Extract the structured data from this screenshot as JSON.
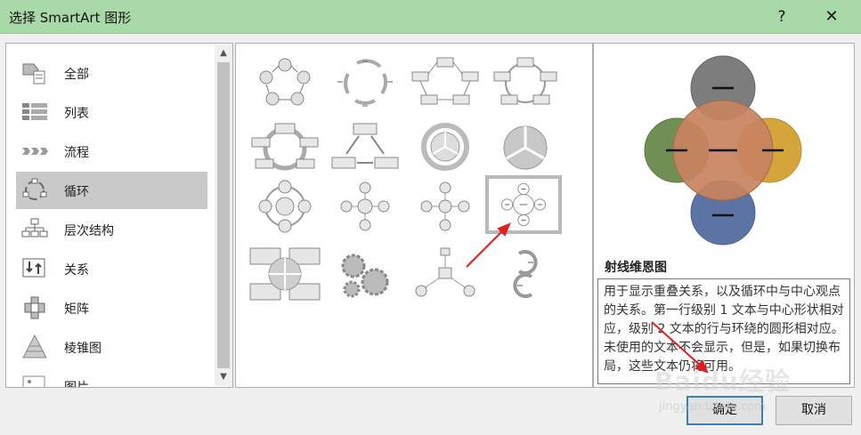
{
  "window": {
    "title": "选择 SmartArt 图形",
    "help_label": "?",
    "close_label": "✕"
  },
  "categories": [
    {
      "label": "全部",
      "icon": "all-icon"
    },
    {
      "label": "列表",
      "icon": "list-icon"
    },
    {
      "label": "流程",
      "icon": "process-icon"
    },
    {
      "label": "循环",
      "icon": "cycle-icon",
      "selected": true
    },
    {
      "label": "层次结构",
      "icon": "hierarchy-icon"
    },
    {
      "label": "关系",
      "icon": "relationship-icon"
    },
    {
      "label": "矩阵",
      "icon": "matrix-icon"
    },
    {
      "label": "棱锥图",
      "icon": "pyramid-icon"
    },
    {
      "label": "图片",
      "icon": "picture-icon"
    }
  ],
  "scroll": {
    "up": "▲",
    "down": "▼"
  },
  "preview": {
    "title": "射线维恩图",
    "description": "用于显示重叠关系，以及循环中与中心观点的关系。第一行级别 1 文本与中心形状相对应，级别 2 文本的行与环绕的圆形相对应。未使用的文本不会显示，但是，如果切换布局，这些文本仍将可用。",
    "colors": {
      "center": "#c8835f",
      "top": "#7d7d7d",
      "left": "#6f8f55",
      "right": "#d4a53b",
      "bottom": "#5b74a3"
    }
  },
  "buttons": {
    "ok": "确定",
    "cancel": "取消"
  },
  "watermark": {
    "main": "Baidu经验",
    "sub": "jingyan.baidu.com"
  }
}
